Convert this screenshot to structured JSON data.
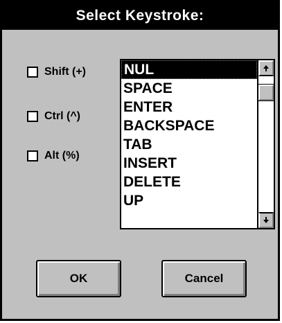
{
  "dialog": {
    "title": "Select Keystroke:"
  },
  "modifiers": [
    {
      "label": "Shift (+)",
      "checked": false
    },
    {
      "label": "Ctrl (^)",
      "checked": false
    },
    {
      "label": "Alt (%)",
      "checked": false
    }
  ],
  "keys": {
    "items": [
      "NUL",
      "SPACE",
      "ENTER",
      "BACKSPACE",
      "TAB",
      "INSERT",
      "DELETE",
      "UP"
    ],
    "selected": "NUL"
  },
  "buttons": {
    "ok_label": "OK",
    "cancel_label": "Cancel"
  },
  "icons": {
    "scroll_up": "arrow-up-icon",
    "scroll_down": "arrow-down-icon"
  },
  "colors": {
    "face": "#c0c0c0",
    "title_bg": "#000000",
    "title_fg": "#ffffff",
    "selection_bg": "#000000"
  }
}
